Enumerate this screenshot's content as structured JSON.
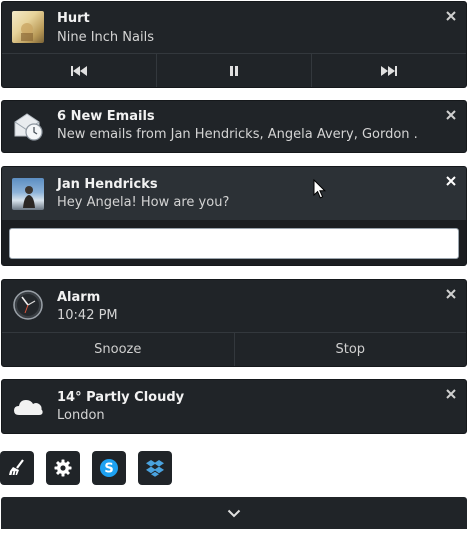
{
  "media": {
    "title": "Hurt",
    "artist": "Nine Inch Nails",
    "controls": [
      "previous",
      "pause",
      "next"
    ]
  },
  "email": {
    "title": "6 New Emails",
    "body": "New emails from Jan Hendricks, Angela Avery, Gordon ..."
  },
  "chat": {
    "sender": "Jan Hendricks",
    "message": "Hey Angela! How are you?",
    "reply_value": ""
  },
  "alarm": {
    "title": "Alarm",
    "time": "10:42 PM",
    "snooze_label": "Snooze",
    "stop_label": "Stop"
  },
  "weather": {
    "title": "14° Partly Cloudy",
    "location": "London"
  },
  "launchers": [
    "broom-icon",
    "gear-icon",
    "skype-icon",
    "dropbox-icon"
  ],
  "colors": {
    "card_bg": "#202428",
    "card_active_bg": "#2c3136",
    "skype_blue": "#1da1f2",
    "dropbox_blue": "#4aa3df"
  }
}
